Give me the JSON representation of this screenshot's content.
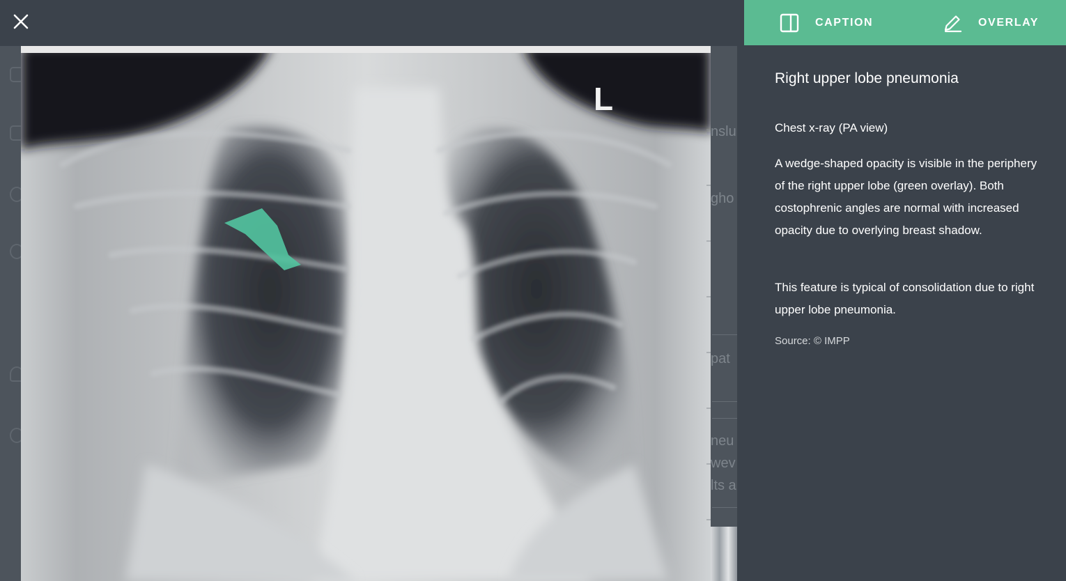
{
  "toolbar": {
    "close_icon": "close-icon",
    "caption_label": "CAPTION",
    "caption_icon": "panel-icon",
    "overlay_label": "OVERLAY",
    "overlay_icon": "pencil-icon",
    "accent_color": "#5bbb92"
  },
  "image": {
    "marker_letter": "L",
    "overlay_color": "#52c4a0"
  },
  "caption": {
    "title": "Right upper lobe pneumonia",
    "view": "Chest x-ray (PA view)",
    "paragraph1": "A wedge-shaped opacity is visible in the periphery of the right upper lobe (green overlay). Both costophrenic angles are normal with increased opacity due to overlying breast shadow.",
    "paragraph2": "This feature is typical of consolidation due to right upper lobe pneumonia.",
    "source": "Source: © IMPP"
  },
  "background_page": {
    "fragments": [
      "nslu",
      "gho",
      "pat",
      "neu",
      "wev",
      "lts a"
    ]
  }
}
